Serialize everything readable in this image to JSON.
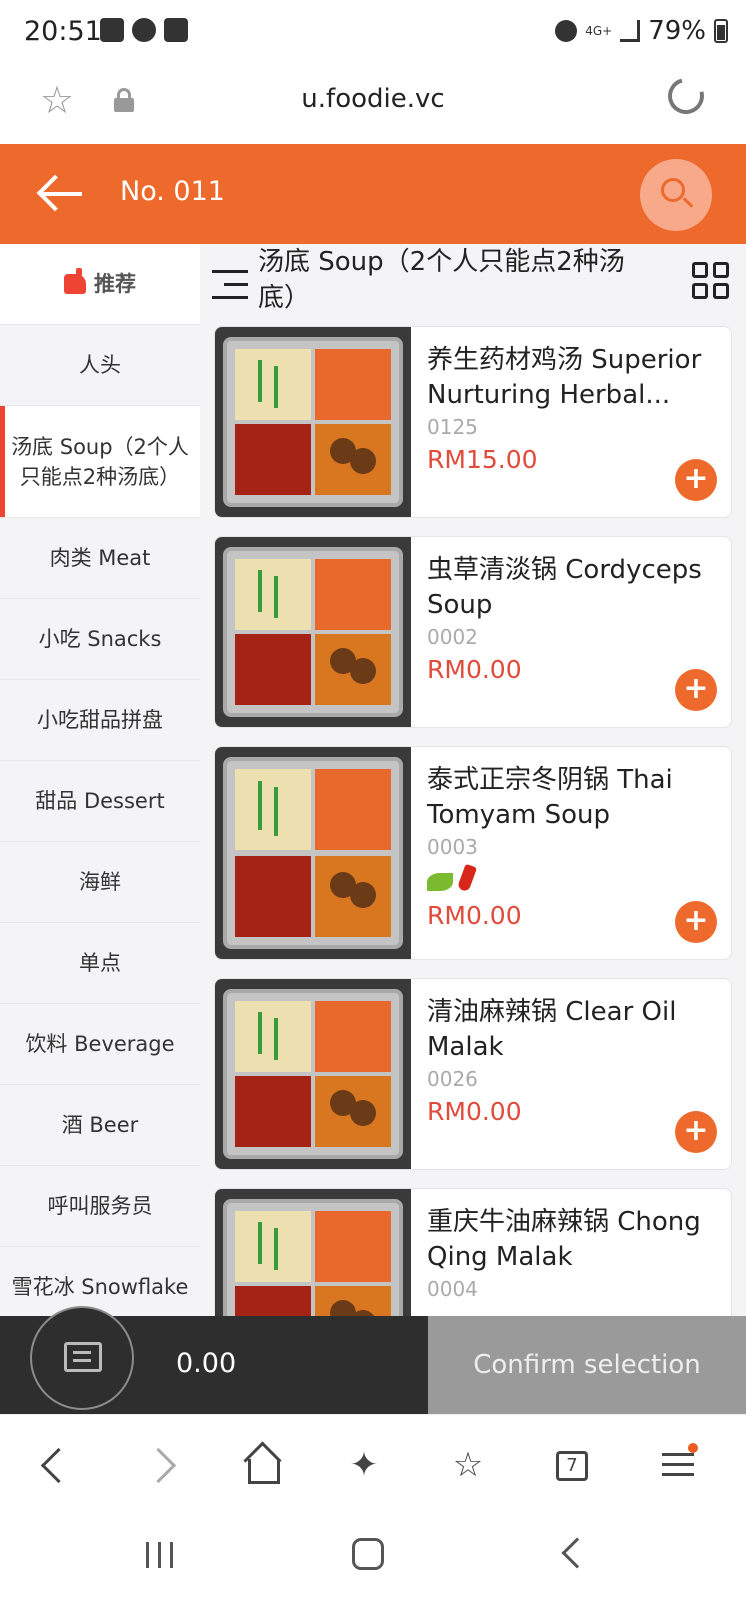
{
  "status_bar": {
    "time": "20:51",
    "network": "4G+",
    "battery": "79%"
  },
  "browser": {
    "url": "u.foodie.vc",
    "tab_count": "7"
  },
  "header": {
    "title": "No. 011",
    "accent_color": "#ee6a2c"
  },
  "sidebar": {
    "items": [
      {
        "label": "推荐"
      },
      {
        "label": "人头"
      },
      {
        "label": "汤底 Soup（2个人只能点2种汤底）"
      },
      {
        "label": "肉类 Meat"
      },
      {
        "label": "小吃 Snacks"
      },
      {
        "label": "小吃甜品拼盘"
      },
      {
        "label": "甜品 Dessert"
      },
      {
        "label": "海鲜"
      },
      {
        "label": "单点"
      },
      {
        "label": "饮料 Beverage"
      },
      {
        "label": "酒 Beer"
      },
      {
        "label": "呼叫服务员"
      },
      {
        "label": "雪花冰 Snowflake"
      }
    ]
  },
  "section": {
    "title": "汤底 Soup（2个人只能点2种汤底）"
  },
  "dishes": [
    {
      "name": "养生药材鸡汤 Superior Nurturing Herbal...",
      "code": "0125",
      "price": "RM15.00"
    },
    {
      "name": "虫草清淡锅 Cordyceps Soup",
      "code": "0002",
      "price": "RM0.00"
    },
    {
      "name": "泰式正宗冬阴锅 Thai Tomyam Soup",
      "code": "0003",
      "price": "RM0.00",
      "tags": [
        "leaf-icon",
        "chili-icon"
      ]
    },
    {
      "name": "清油麻辣锅 Clear Oil Malak",
      "code": "0026",
      "price": "RM0.00"
    },
    {
      "name": "重庆牛油麻辣锅 Chong Qing Malak",
      "code": "0004",
      "price": ""
    }
  ],
  "cart": {
    "total": "0.00",
    "confirm_label": "Confirm selection"
  }
}
